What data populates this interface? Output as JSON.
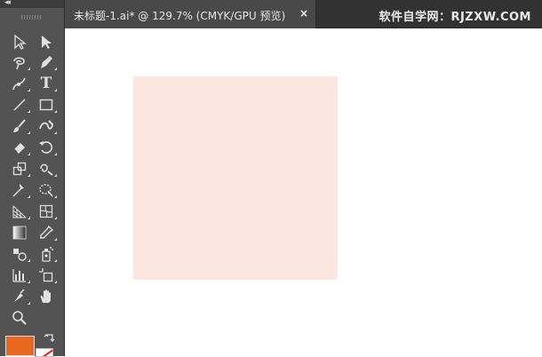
{
  "document_tab": {
    "title": "未标题-1.ai* @ 129.7% (CMYK/GPU 预览)",
    "close_glyph": "×"
  },
  "watermark": "软件自学网：RJZXW.COM",
  "toolbar": {
    "collapse_glyph": "◂◂",
    "type_tool_glyph": "T",
    "tools": [
      "selection-tool",
      "direct-selection-tool",
      "magic-wand-tool",
      "pen-tool",
      "curvature-tool",
      "type-tool",
      "line-segment-tool",
      "rectangle-tool",
      "paintbrush-tool",
      "shaper-tool",
      "eraser-tool",
      "rotate-tool",
      "scale-tool",
      "warp-tool",
      "puppet-warp-tool",
      "free-transform-tool",
      "perspective-grid-tool",
      "mesh-tool",
      "gradient-tool",
      "eyedropper-tool",
      "blend-tool",
      "symbol-sprayer-tool",
      "column-graph-tool",
      "artboard-tool",
      "slice-tool",
      "hand-tool",
      "zoom-tool"
    ]
  },
  "colors": {
    "fill": "#e8681f",
    "stroke": "none",
    "shape_fill": "#fbe6e0"
  }
}
